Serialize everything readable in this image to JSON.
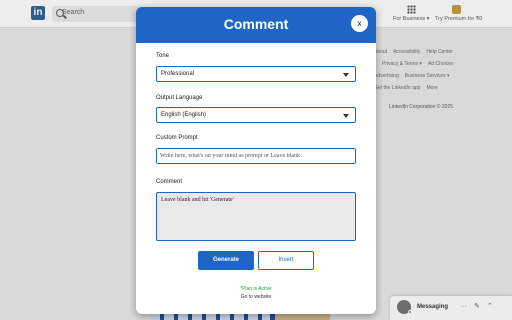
{
  "background": {
    "logo": "in",
    "search_placeholder": "Search",
    "for_business": "For Business ▾",
    "try_premium": "Try Premium for ₹0",
    "footer_rows": [
      [
        "About",
        "Accessibility",
        "Help Center"
      ],
      [
        "Privacy & Terms ▾",
        "Ad Choices"
      ],
      [
        "Advertising",
        "Business Services ▾"
      ],
      [
        "Get the LinkedIn app",
        "More"
      ]
    ],
    "copyright": "LinkedIn Corporation © 2025",
    "messaging_label": "Messaging",
    "messaging_dots": "···",
    "messaging_compose": "✎",
    "messaging_chevron": "⌃"
  },
  "modal": {
    "title": "Comment",
    "close_label": "x",
    "tone": {
      "label": "Tone",
      "value": "Professional"
    },
    "language": {
      "label": "Output Language",
      "value": "English (English)"
    },
    "custom_prompt": {
      "label": "Custom Prompt",
      "value": "",
      "placeholder": "Write here, what's on your mind as prompt or Leave blank"
    },
    "comment": {
      "label": "Comment",
      "value": "Leave blank and hit 'Generate'"
    },
    "generate_label": "Generate",
    "insert_label": "Insert",
    "plan_status": "*Plan is Active",
    "website_link": "Go to website"
  },
  "colors": {
    "accent": "#1f65c6",
    "plan_active": "#2e9e3a",
    "overlay_bg": "#d9d9d9"
  }
}
